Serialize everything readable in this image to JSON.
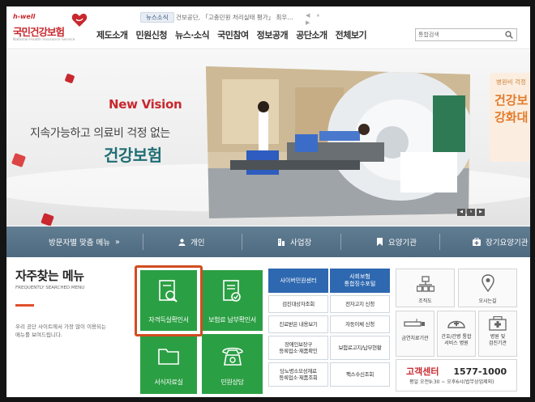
{
  "header": {
    "logo_tagline": "h-well",
    "logo_name": "국민건강보험",
    "logo_sub": "National Health Insurance Service",
    "ticker_tag": "뉴스소식",
    "ticker_text": "건보공단, 「고충민원 처리실태 평가」 최우...",
    "ticker_controls": "◀ ⏸ ▶",
    "nav": [
      "제도소개",
      "민원신청",
      "뉴스·소식",
      "국민참여",
      "정보공개",
      "공단소개",
      "전체보기"
    ],
    "search_placeholder": "통합검색"
  },
  "banner": {
    "eyebrow": "New Vision",
    "subtitle": "지속가능하고 의료비 걱정 없는",
    "headline": "건강보험",
    "teaser_small": "병원비 걱정",
    "teaser_line1": "건강보",
    "teaser_line2": "강화대",
    "controls": [
      "◀",
      "⏸",
      "▶"
    ]
  },
  "quickbar": {
    "title": "방문자별 맞춤 메뉴",
    "title_arrow": "»",
    "items": [
      "개인",
      "사업장",
      "요양기관",
      "장기요양기관"
    ]
  },
  "faq": {
    "title": "자주찾는 메뉴",
    "title_en": "FREQUENTLY SEARCHED MENU",
    "description": "우리 공단 사이트에서 가장 많이 이용되는 메뉴를 보여드립니다.",
    "tiles": [
      "자격득실확인서",
      "보험료 납부확인서",
      "서식자료실",
      "민원상담"
    ]
  },
  "services": {
    "headers": [
      "사이버민원센터",
      "사회보험\n통합징수포털"
    ],
    "rows": [
      [
        "검진대상자조회",
        "전자고지 신청"
      ],
      [
        "진료받은 내용보기",
        "자동이체 신청"
      ],
      [
        "장애인보장구\n등록업소·제품확인",
        "보험료고지/납부현황"
      ],
      [
        "당뇨병소모성재료\n등록업소·제품조회",
        "팩스수신조회"
      ]
    ]
  },
  "icons_grid": {
    "items": [
      "조직도",
      "오시는길",
      "금연치료기관",
      "간호/간병 통합\n서비스 병원",
      "병원 및\n검진기관"
    ]
  },
  "customer_center": {
    "label": "고객센터",
    "phone": "1577-1000",
    "hours": "평일 오전9:30 ~ 오후6시(법무상업제외)"
  },
  "colors": {
    "brand_red": "#c8282e",
    "teal": "#1f6e74",
    "green_tile": "#2b9f44",
    "blue_header": "#2e68b0",
    "quickbar": "#5a7489",
    "highlight": "#d24d21"
  }
}
